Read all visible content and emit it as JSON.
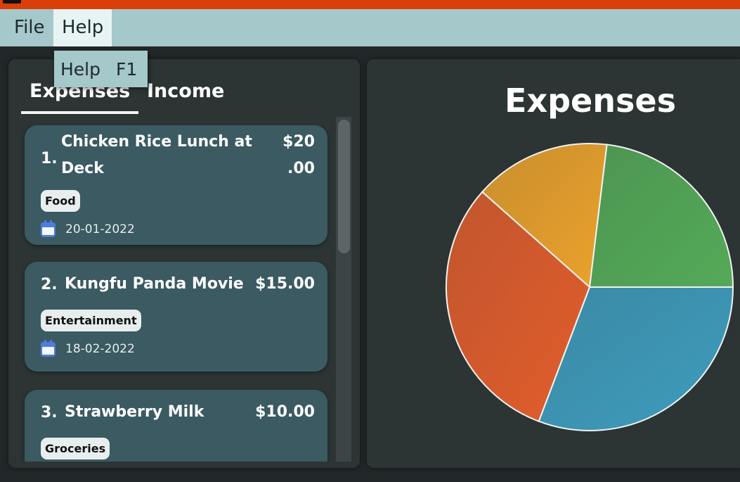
{
  "menubar": {
    "file_label": "File",
    "help_label": "Help"
  },
  "dropdown": {
    "item_label": "Help",
    "item_shortcut": "F1"
  },
  "tabs": [
    {
      "label": "Expenses",
      "selected": true
    },
    {
      "label": "Income",
      "selected": false
    }
  ],
  "expenses": [
    {
      "index": "1.",
      "title_line1": "Chicken Rice Lunch at",
      "title_line2": "Deck",
      "amount_line1": "$20",
      "amount_line2": ".00",
      "tag": "Food",
      "date": "20-01-2022"
    },
    {
      "index": "2.",
      "title": "Kungfu Panda Movie",
      "amount": "$15.00",
      "tag": "Entertainment",
      "date": "18-02-2022"
    },
    {
      "index": "3.",
      "title": "Strawberry Milk",
      "amount": "$10.00",
      "tag": "Groceries",
      "date": ""
    }
  ],
  "chart_data": {
    "type": "pie",
    "title": "Expenses",
    "slices": [
      {
        "value": 20,
        "color": "#3e9cbd"
      },
      {
        "value": 20,
        "color": "#e25d2c"
      },
      {
        "value": 10,
        "color": "#eba22c"
      },
      {
        "value": 15,
        "color": "#54aa58"
      }
    ]
  },
  "icons": {
    "date_icon": "calendar-icon"
  },
  "colors": {
    "titlebar": "#dc3e0a",
    "menubar": "#a5c8ca",
    "card": "#3b5a62",
    "panel": "#2c3434"
  }
}
